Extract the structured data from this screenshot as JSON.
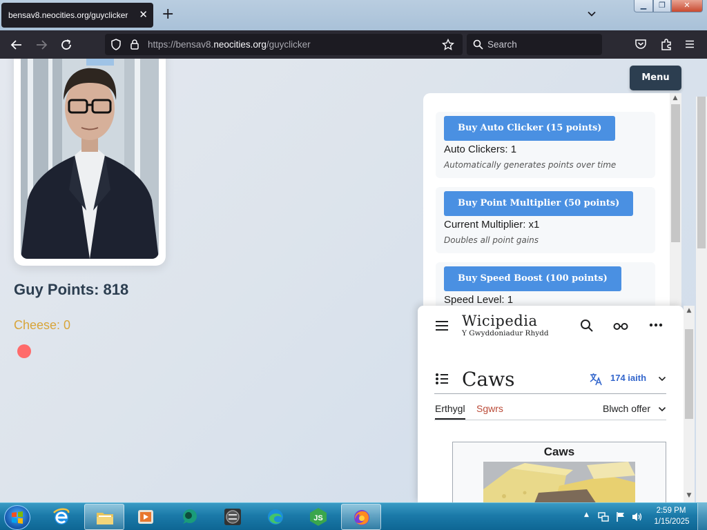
{
  "browser": {
    "tab_title": "bensav8.neocities.org/guyclicker",
    "url_prefix": "https://bensav8.",
    "url_domain": "neocities.org",
    "url_path": "/guyclicker",
    "search_placeholder": "Search"
  },
  "game": {
    "guy_points_label": "Guy Points: 818",
    "cheese_label": "Cheese: 0",
    "menu_label": "Menu",
    "shop": [
      {
        "button": "Buy Auto Clicker (15 points)",
        "stat": "Auto Clickers: 1",
        "desc": "Automatically generates points over time"
      },
      {
        "button": "Buy Point Multiplier (50 points)",
        "stat": "Current Multiplier: x1",
        "desc": "Doubles all point gains"
      },
      {
        "button": "Buy Speed Boost (100 points)",
        "stat": "Speed Level: 1",
        "desc": ""
      }
    ]
  },
  "wiki": {
    "logo": "Wicipedia",
    "tagline": "Y Gwyddoniadur Rhydd",
    "article_title": "Caws",
    "languages": "174 iaith",
    "tab_article": "Erthygl",
    "tab_talk": "Sgwrs",
    "tools": "Blwch offer",
    "infobox_title": "Caws"
  },
  "taskbar": {
    "time": "2:59 PM",
    "date": "1/15/2025"
  }
}
